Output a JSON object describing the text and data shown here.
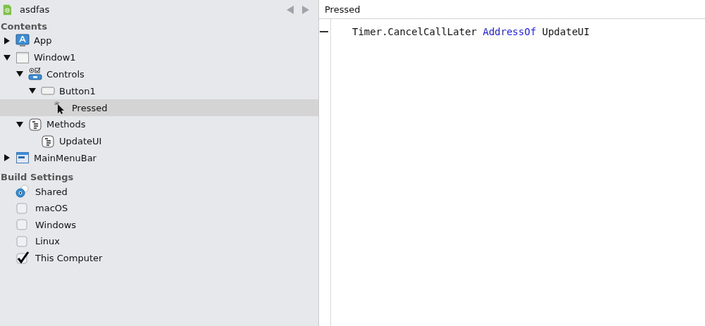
{
  "project": {
    "title": "asdfas"
  },
  "contents": {
    "heading": "Contents",
    "items": [
      {
        "label": "App",
        "kind": "app",
        "expanded": false,
        "selected": false
      },
      {
        "label": "Window1",
        "kind": "window",
        "expanded": true,
        "selected": false,
        "children": [
          {
            "label": "Controls",
            "kind": "controls",
            "expanded": true,
            "selected": false,
            "children": [
              {
                "label": "Button1",
                "kind": "button",
                "expanded": true,
                "selected": false,
                "children": [
                  {
                    "label": "Pressed",
                    "kind": "event",
                    "selected": true
                  }
                ]
              }
            ]
          },
          {
            "label": "Methods",
            "kind": "method",
            "expanded": true,
            "selected": false,
            "children": [
              {
                "label": "UpdateUI",
                "kind": "method",
                "selected": false
              }
            ]
          }
        ]
      },
      {
        "label": "MainMenuBar",
        "kind": "menubar",
        "expanded": false,
        "selected": false
      }
    ]
  },
  "build_settings": {
    "heading": "Build Settings",
    "items": [
      {
        "label": "Shared",
        "kind": "radio",
        "checked": true
      },
      {
        "label": "macOS",
        "kind": "checkbox",
        "checked": false
      },
      {
        "label": "Windows",
        "kind": "checkbox",
        "checked": false
      },
      {
        "label": "Linux",
        "kind": "checkbox",
        "checked": false
      },
      {
        "label": "This Computer",
        "kind": "checkbox",
        "checked": true
      }
    ]
  },
  "editor": {
    "title": "Pressed",
    "lines": [
      {
        "tokens": [
          {
            "text": "Timer.CancelCallLater",
            "kind": "plain"
          },
          {
            "text": "AddressOf",
            "kind": "keyword"
          },
          {
            "text": "UpdateUI",
            "kind": "plain"
          }
        ]
      }
    ]
  }
}
